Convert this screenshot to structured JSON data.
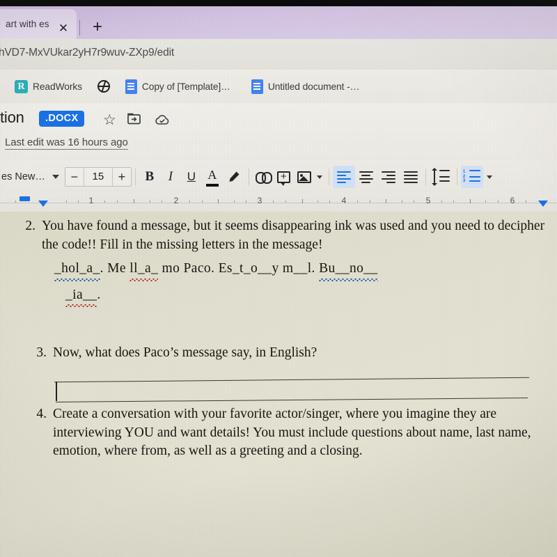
{
  "browser": {
    "tab": {
      "title": "art with es",
      "close_icon": "close-icon"
    },
    "new_tab_icon": "plus-icon",
    "url": "hVD7-MxVUkar2yH7r9wuv-ZXp9/edit",
    "bookmarks": [
      {
        "label": "ReadWorks",
        "icon": "readworks-icon",
        "icon_letter": "R"
      },
      {
        "label": "",
        "icon": "globe-icon"
      },
      {
        "label": "Copy of [Template]…",
        "icon": "google-docs-icon"
      },
      {
        "label": "Untitled document -…",
        "icon": "google-docs-icon"
      }
    ]
  },
  "docs": {
    "title": "tion",
    "format_badge": ".DOCX",
    "star_icon": "☆",
    "move_folder_icon": "⧉",
    "cloud_icon": "☁",
    "last_edit": "Last edit was 16 hours ago",
    "toolbar": {
      "font_name": "es New…",
      "decrease_label": "−",
      "font_size": "15",
      "increase_label": "+",
      "bold_label": "B",
      "italic_label": "I",
      "underline_label": "U",
      "text_color_label": "A",
      "highlight_icon": "highlighter-icon",
      "link_icon": "link-icon",
      "comment_icon": "add-comment-icon",
      "image_icon": "insert-image-icon",
      "align_left_icon": "align-left-icon",
      "align_center_icon": "align-center-icon",
      "align_right_icon": "align-right-icon",
      "align_justify_icon": "align-justify-icon",
      "line_spacing_icon": "line-spacing-icon",
      "numbered_list_icon": "numbered-list-icon",
      "active_alignment": "left",
      "accent_color": "#1a73e8"
    },
    "ruler": {
      "numbers": [
        "1",
        "2",
        "3",
        "4",
        "5",
        "6"
      ],
      "marker_color": "#1a73e8"
    }
  },
  "document": {
    "questions": [
      {
        "number": "2.",
        "text": "You have found a message, but it seems disappearing ink was used and you need to decipher the code!!  Fill in the missing letters in the message!"
      },
      {
        "number": "3.",
        "text": "Now, what does Paco’s message say, in English?"
      },
      {
        "number": "4.",
        "text": "Create a conversation with your favorite actor/singer, where you imagine they are interviewing YOU and want details!   You must include questions about name, last name, emotion, where from, as well as a greeting and a closing."
      }
    ],
    "fill_in_line_1": {
      "seg_hola": "_hol_a_",
      "after_hola": ".  Me  ",
      "seg_llama": "ll_a_",
      "after_llama": " mo  Paco.  Es_t_o__y   m__l.  ",
      "seg_bueno": "Bu__no__"
    },
    "fill_in_line_2": {
      "seg_ia": "_ia__",
      "after_ia": "."
    },
    "spellcheck_colors": {
      "red": "#b3291f",
      "blue": "#1d4fa8"
    }
  }
}
